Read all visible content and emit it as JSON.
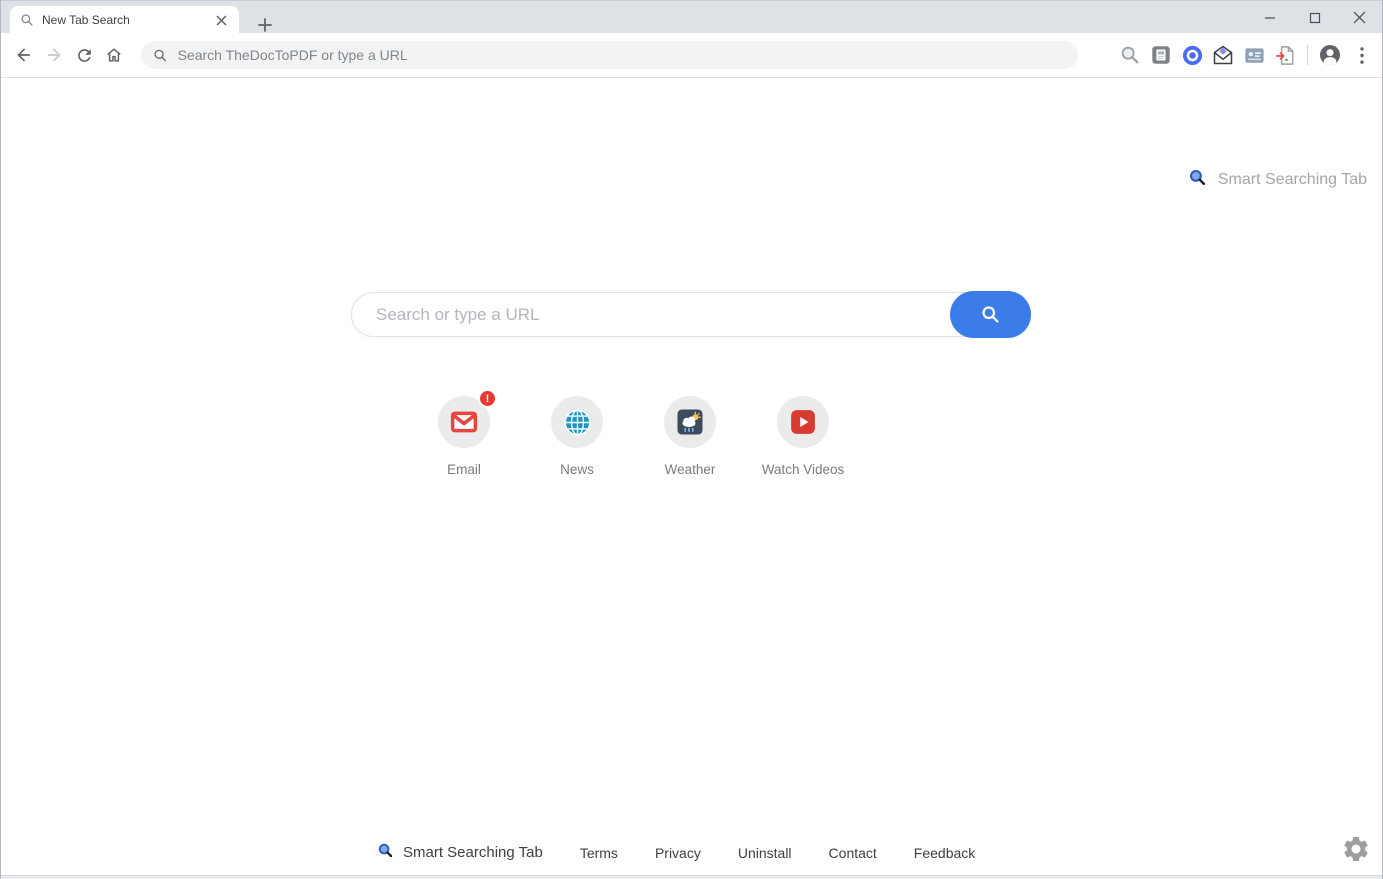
{
  "browser": {
    "tab_title": "New Tab Search",
    "address_placeholder": "Search TheDocToPDF or type a URL",
    "extension_icons": [
      "magnifier-icon",
      "news-reader-icon",
      "blue-ring-icon",
      "envelope-gem-icon",
      "contact-card-icon",
      "doc-to-pdf-icon"
    ]
  },
  "page": {
    "brand": "Smart Searching Tab",
    "search_placeholder": "Search or type a URL",
    "shortcuts": [
      {
        "label": "Email",
        "badge": "!"
      },
      {
        "label": "News"
      },
      {
        "label": "Weather"
      },
      {
        "label": "Watch Videos"
      }
    ],
    "footer": {
      "brand": "Smart Searching Tab",
      "links": [
        "Terms",
        "Privacy",
        "Uninstall",
        "Contact",
        "Feedback"
      ]
    }
  },
  "colors": {
    "accent_blue": "#3b7ce9",
    "email_red": "#e8453c",
    "badge_red": "#e53935",
    "news_blue": "#1c96c9",
    "weather_navy": "#3e4b5e",
    "video_red": "#d93b30",
    "titlebar_gray": "#dee1e6"
  }
}
